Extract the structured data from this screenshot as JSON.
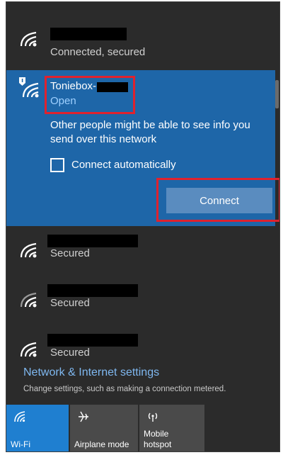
{
  "networks": {
    "connected": {
      "status": "Connected, secured"
    },
    "selected": {
      "name": "Toniebox-",
      "status": "Open",
      "warning": "Other people might be able to see info you send over this network",
      "auto_connect_label": "Connect automatically",
      "auto_connect_checked": false,
      "connect_label": "Connect"
    },
    "others": [
      {
        "status": "Secured"
      },
      {
        "status": "Secured"
      },
      {
        "status": "Secured"
      }
    ]
  },
  "settings": {
    "title": "Network & Internet settings",
    "subtitle": "Change settings, such as making a connection metered."
  },
  "quick_actions": [
    {
      "label": "Wi-Fi",
      "icon": "wifi-icon",
      "active": true
    },
    {
      "label": "Airplane mode",
      "icon": "airplane-icon",
      "active": false
    },
    {
      "label": "Mobile hotspot",
      "icon": "hotspot-icon",
      "active": false
    }
  ],
  "colors": {
    "panel": "#2b2b2b",
    "selected_bg": "#1e66a8",
    "accent": "#1f7fd0",
    "highlight": "#e0222e",
    "link": "#7fb8f0"
  }
}
